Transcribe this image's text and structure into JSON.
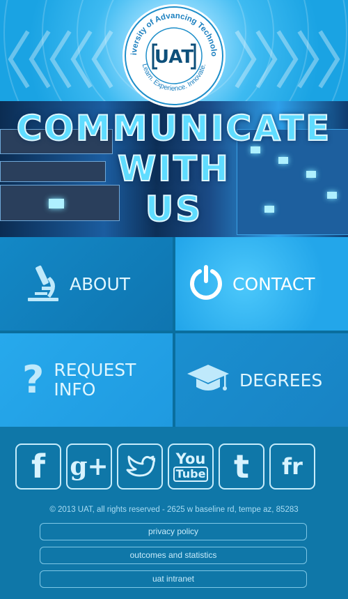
{
  "logo": {
    "ring_text": "University of Advancing Technology",
    "tagline": "Learn. Experience. Innovate.",
    "mark": "UAT"
  },
  "banner": {
    "line1": "COMMUNICATE",
    "line2": "WITH",
    "line3": "US"
  },
  "tiles": [
    {
      "label": "ABOUT",
      "icon": "microscope-icon"
    },
    {
      "label": "CONTACT",
      "icon": "power-icon"
    },
    {
      "label_line1": "REQUEST",
      "label_line2": "INFO",
      "icon": "question-mark-icon"
    },
    {
      "label": "DEGREES",
      "icon": "graduation-cap-icon"
    }
  ],
  "social": [
    {
      "name": "facebook-icon",
      "glyph": "f"
    },
    {
      "name": "google-plus-icon",
      "glyph": "g+"
    },
    {
      "name": "twitter-icon",
      "glyph": "bird"
    },
    {
      "name": "youtube-icon",
      "glyph_line1": "You",
      "glyph_line2": "Tube"
    },
    {
      "name": "tumblr-icon",
      "glyph": "t"
    },
    {
      "name": "flickr-icon",
      "glyph": "fr"
    }
  ],
  "footer": {
    "copyright": "© 2013 UAT, all rights reserved - 2625 w baseline rd, tempe az, 85283",
    "links": [
      "privacy policy",
      "outcomes and statistics",
      "uat intranet"
    ]
  },
  "colors": {
    "header_light": "#9ee0ff",
    "tile_dark": "#117fbb",
    "tile_light": "#2cb0ee",
    "footer_bg": "#0f77a8",
    "text_light": "#dff6ff"
  }
}
